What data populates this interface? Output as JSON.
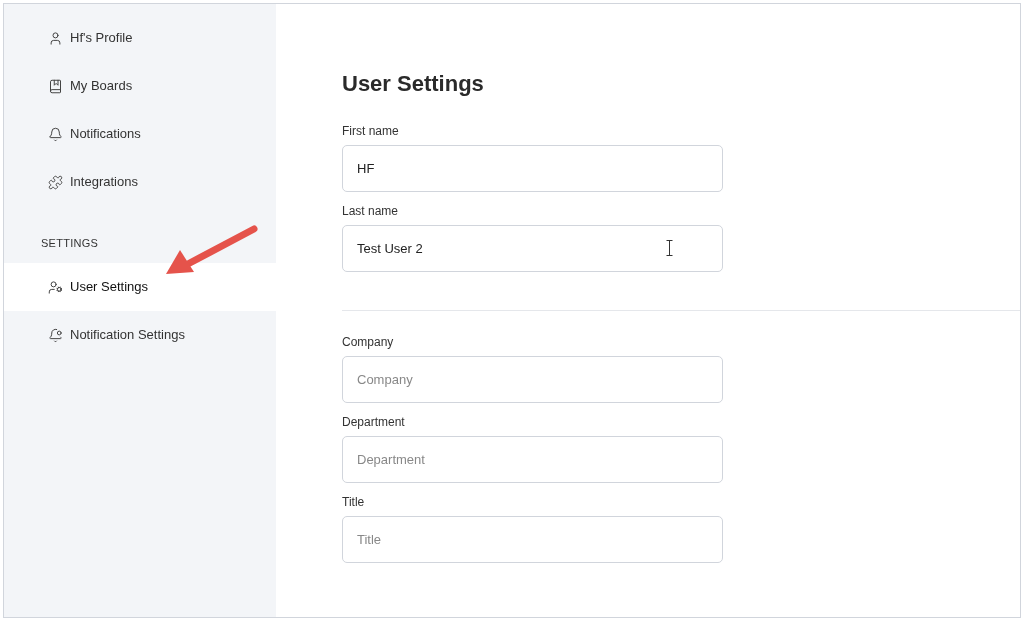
{
  "sidebar": {
    "groups": [
      {
        "items": [
          {
            "label": "Hf's Profile",
            "selected": false
          },
          {
            "label": "My Boards",
            "selected": false
          },
          {
            "label": "Notifications",
            "selected": false
          },
          {
            "label": "Integrations",
            "selected": false
          }
        ]
      },
      {
        "heading": "SETTINGS",
        "items": [
          {
            "label": "User Settings",
            "selected": true
          },
          {
            "label": "Notification Settings",
            "selected": false
          }
        ]
      }
    ]
  },
  "main": {
    "title": "User Settings",
    "sections": [
      {
        "fields": [
          {
            "label": "First name",
            "value": "HF"
          },
          {
            "label": "Last name",
            "value": "Test User 2",
            "cursor": true
          }
        ]
      },
      {
        "fields": [
          {
            "label": "Company",
            "placeholder": "Company"
          },
          {
            "label": "Department",
            "placeholder": "Department"
          },
          {
            "label": "Title",
            "placeholder": "Title"
          }
        ]
      }
    ]
  }
}
